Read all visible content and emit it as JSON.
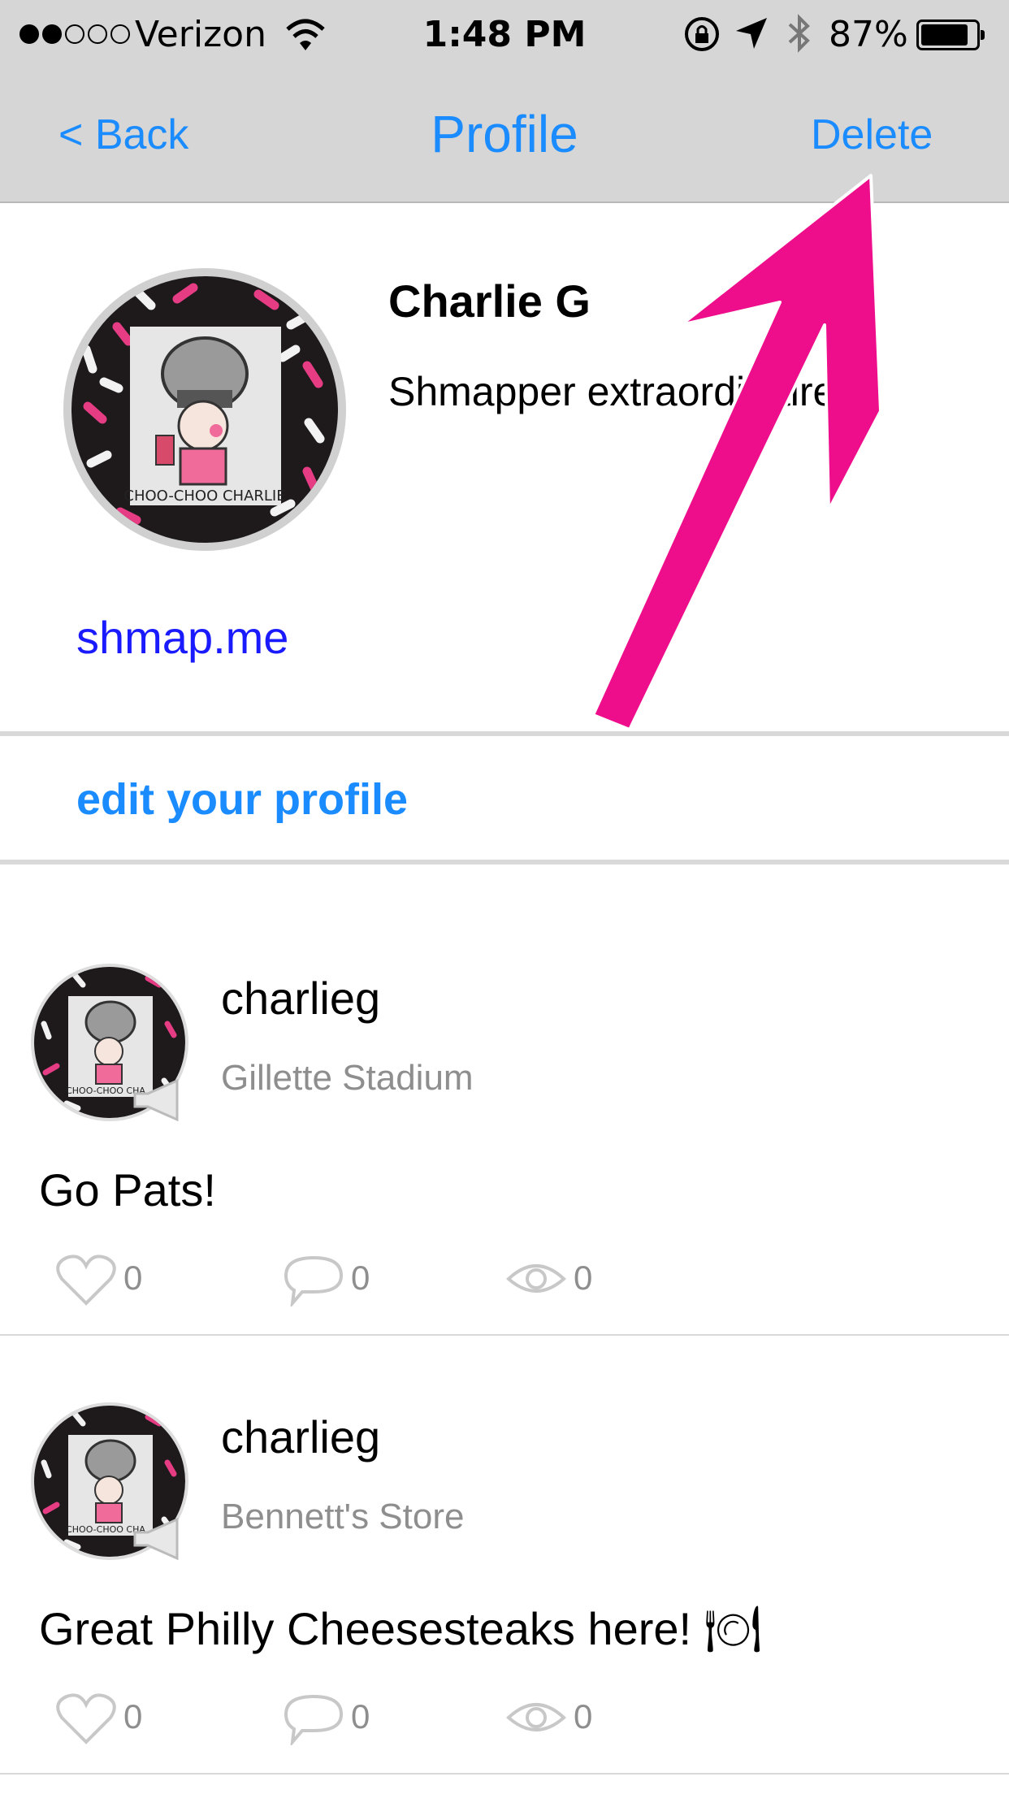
{
  "status_bar": {
    "carrier": "Verizon",
    "time": "1:48 PM",
    "battery": "87%",
    "battery_level": 0.87,
    "signal_bars_filled": 2,
    "signal_bars_total": 5,
    "icons": [
      "wifi-icon",
      "rotation-lock-icon",
      "location-arrow-icon",
      "bluetooth-icon",
      "battery-icon"
    ]
  },
  "nav": {
    "back_label": "< Back",
    "title": "Profile",
    "delete_label": "Delete"
  },
  "profile": {
    "name": "Charlie G",
    "bio": "Shmapper extraordinaire.",
    "link": "shmap.me",
    "edit_label": "edit your profile"
  },
  "posts": [
    {
      "username": "charlieg",
      "place": "Gillette Stadium",
      "text": "Go Pats!",
      "likes": "0",
      "comments": "0",
      "views": "0"
    },
    {
      "username": "charlieg",
      "place": "Bennett's Store",
      "text": "Great Philly Cheesesteaks here! 🍽",
      "likes": "0",
      "comments": "0",
      "views": "0"
    }
  ],
  "colors": {
    "accent": "#1a8cff",
    "link": "#1a1aff",
    "annotation": "#ee0e8c",
    "nav_bg": "#d6d6d6"
  }
}
